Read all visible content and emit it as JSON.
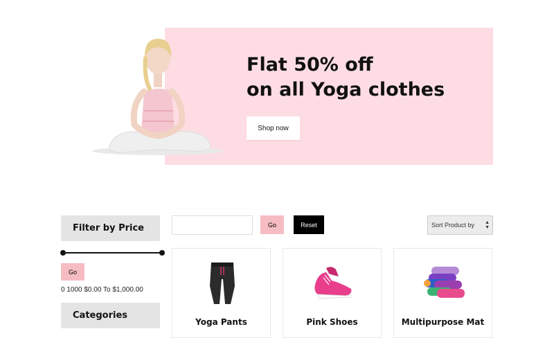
{
  "hero": {
    "title": "Flat 50% off\non all Yoga clothes",
    "button_label": "Shop now",
    "background": "#fddde3"
  },
  "sidebar": {
    "filter_heading": "Filter by Price",
    "go_label": "Go",
    "price_range_text": "0 1000 $0.00 To $1,000.00",
    "categories_heading": "Categories"
  },
  "toolbar": {
    "search_value": "",
    "go_label": "Go",
    "reset_label": "Reset",
    "sort_selected": "Sort Product by"
  },
  "products": [
    {
      "name": "Yoga Pants",
      "icon": "yoga-pants-image"
    },
    {
      "name": "Pink Shoes",
      "icon": "pink-shoes-image"
    },
    {
      "name": "Multipurpose Mat",
      "icon": "yoga-mat-image"
    }
  ],
  "colors": {
    "accent_pink": "#f6bcc3",
    "banner_pink": "#fddde3",
    "panel_gray": "#e4e4e4"
  }
}
